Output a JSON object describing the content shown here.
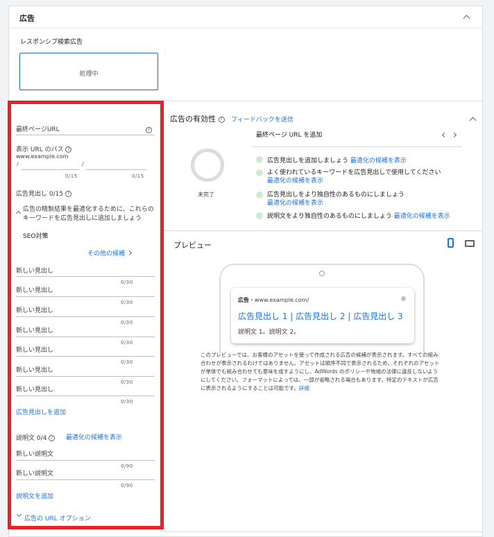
{
  "header": {
    "title": "広告"
  },
  "ad_type": {
    "label": "レスポンシブ検索広告",
    "processing_label": "処理中"
  },
  "form": {
    "final_url": {
      "label": "最終ページURL"
    },
    "display_path": {
      "label": "表示 URL のパス",
      "domain": "www.example.com",
      "sep1": "/",
      "sep2": "/",
      "count1": "0/15",
      "count2": "0/15"
    },
    "headlines": {
      "label": "広告見出し 0/15",
      "suggestion_text": "広告の精製結果を最適化するために、これらのキーワードを広告見出しに追加しましょう",
      "keyword_chip": "SEO対策",
      "more_ideas": "その他の候補",
      "items": [
        {
          "placeholder": "新しい見出し",
          "count": "0/30"
        },
        {
          "placeholder": "新しい見出し",
          "count": "0/30"
        },
        {
          "placeholder": "新しい見出し",
          "count": "0/30"
        },
        {
          "placeholder": "新しい見出し",
          "count": "0/30"
        },
        {
          "placeholder": "新しい見出し",
          "count": "0/30"
        },
        {
          "placeholder": "新しい見出し",
          "count": "0/30"
        },
        {
          "placeholder": "新しい見出し",
          "count": "0/30"
        }
      ],
      "add_link": "広告見出しを追加"
    },
    "descriptions": {
      "label": "説明文 0/4",
      "ideas_link": "最適化の候補を表示",
      "items": [
        {
          "placeholder": "新しい説明文",
          "count": "0/90"
        },
        {
          "placeholder": "新しい説明文",
          "count": "0/90"
        }
      ],
      "add_link": "説明文を追加"
    },
    "url_options": "広告の URL オプション"
  },
  "ad_strength": {
    "title": "広告の有効性",
    "feedback_link": "フィードバックを送信",
    "status": "未完了",
    "tip_header": "最終ページ URL を追加",
    "tips": [
      {
        "text": "広告見出しを追加しましょう",
        "link": "最適化の候補を表示"
      },
      {
        "text": "よく使われているキーワードを広告見出しで使用してください",
        "link": "最適化の候補を表示"
      },
      {
        "text": "広告見出しをより独自性のあるものにしましょう",
        "link": "最適化の候補を表示"
      },
      {
        "text": "説明文をより独自性のあるものにしましょう",
        "link": "最適化の候補を表示"
      }
    ]
  },
  "preview": {
    "title": "プレビュー",
    "ad_badge": "広告",
    "ad_url": "・www.example.com/",
    "ad_headline": "広告見出し 1 | 広告見出し 2 | 広告見出し 3",
    "ad_description": "説明文 1。説明文 2。",
    "disclaimer": "このプレビューでは、お客様のアセットを使って作成される広告の候補が表示されます。すべての組み合わせが表示されるわけではありません。アセットは順序不同で表示されるため、それぞれのアセットが単体でも組み合わせても意味を成すようにし、AdWords のポリシーや地域の法律に違反しないようにしてください。フォーマットによっては、一部が省略される場合もあります。特定のテキストが広告に表示されるようにすることは可能です。",
    "disclaimer_link": "詳細"
  },
  "colors": {
    "accent": "#1a73e8",
    "highlight": "#e8202a",
    "tip_dot": "#ceead6"
  }
}
